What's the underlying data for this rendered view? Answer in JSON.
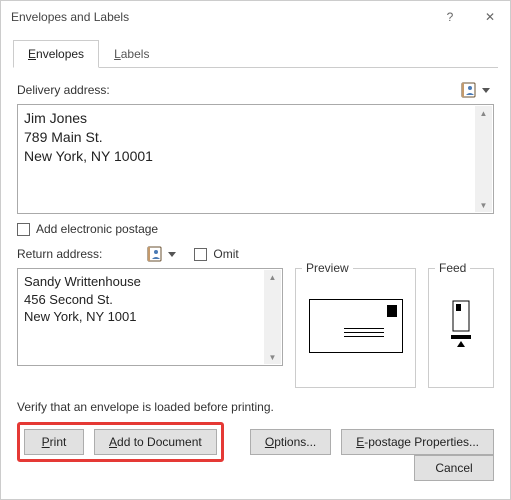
{
  "window": {
    "title": "Envelopes and Labels",
    "help_tooltip": "?",
    "close_tooltip": "✕"
  },
  "tabs": {
    "envelopes": "Envelopes",
    "labels": "Labels"
  },
  "delivery": {
    "label": "Delivery address:",
    "value": "Jim Jones\n789 Main St.\nNew York, NY 10001"
  },
  "electronic_postage": {
    "label": "Add electronic postage",
    "checked": false
  },
  "return": {
    "label": "Return address:",
    "omit_label": "Omit",
    "omit_checked": false,
    "value": "Sandy Writtenhouse\n456 Second St.\nNew York, NY 1001"
  },
  "preview": {
    "title": "Preview"
  },
  "feed": {
    "title": "Feed"
  },
  "verify_text": "Verify that an envelope is loaded before printing.",
  "buttons": {
    "print": "Print",
    "add_to_document": "Add to Document",
    "options": "Options...",
    "epostage": "E-postage Properties...",
    "cancel": "Cancel"
  },
  "icons": {
    "address_book": "address-book-icon",
    "dropdown": "chevron-down-icon"
  }
}
